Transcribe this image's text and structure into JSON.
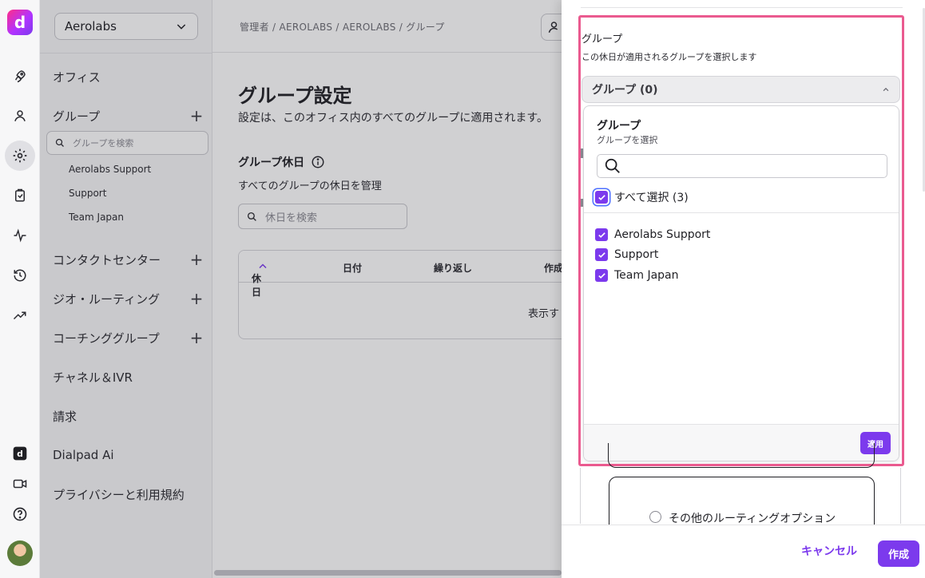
{
  "rail": {
    "logo": "d",
    "icons": [
      "rocket-icon",
      "person-icon",
      "gear-icon",
      "clipboard-icon",
      "activity-icon",
      "history-icon",
      "trending-icon",
      "dialpad-icon",
      "video-icon",
      "help-icon"
    ]
  },
  "sidebar": {
    "office": "Aerolabs",
    "items": {
      "office": "オフィス",
      "groups": "グループ",
      "contact_center": "コンタクトセンター",
      "geo_routing": "ジオ・ルーティング",
      "coaching": "コーチンググループ",
      "channels": "チャネル＆IVR",
      "billing": "請求",
      "dialpad_ai": "Dialpad Ai",
      "privacy": "プライバシーと利用規約"
    },
    "group_search_placeholder": "グループを検索",
    "group_list": [
      "Aerolabs Support",
      "Support",
      "Team Japan"
    ]
  },
  "main": {
    "breadcrumb": "管理者 / AEROLABS / AEROLABS / グループ",
    "title": "グループ設定",
    "description": "設定は、このオフィス内のすべてのグループに適用されます。",
    "holidays_title": "グループ休日",
    "holidays_desc": "すべてのグループの休日を管理",
    "holiday_search_placeholder": "休日を検索",
    "table_headers": [
      "休日",
      "日付",
      "繰り返し",
      "作成"
    ],
    "empty_text": "表示す"
  },
  "drawer": {
    "field_label": "グループ",
    "field_help": "この休日が適用されるグループを選択します",
    "trigger_label": "グループ (0)",
    "panel_title": "グループ",
    "panel_subtitle": "グループを選択",
    "select_all": "すべて選択 (3)",
    "options": [
      "Aerolabs Support",
      "Support",
      "Team Japan"
    ],
    "apply": "適用",
    "other_routing": "その他のルーティングオプション",
    "cancel": "キャンセル",
    "create": "作成"
  },
  "colors": {
    "accent": "#7c3aed",
    "highlight": "#ea5a8f"
  }
}
